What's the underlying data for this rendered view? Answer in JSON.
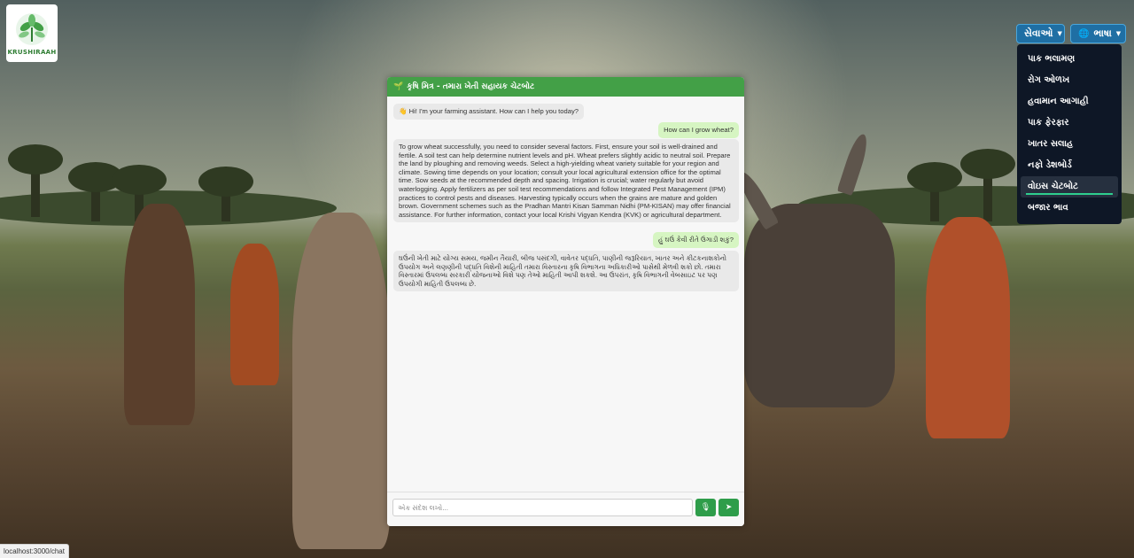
{
  "logo": {
    "text": "KRUSHIRAAH"
  },
  "header": {
    "services_label": "સેવાઓ",
    "language_label": "ભાષા"
  },
  "services_menu": {
    "items": [
      {
        "label": "પાક ભલામણ"
      },
      {
        "label": "રોગ ઓળખ"
      },
      {
        "label": "હવામાન આગાહી"
      },
      {
        "label": "પાક ફેરફાર"
      },
      {
        "label": "ખાતર સલાહ"
      },
      {
        "label": "નફો ડેશબોર્ડ"
      },
      {
        "label": "વોઇસ ચેટબોટ",
        "active": true
      },
      {
        "label": "બજાર ભાવ"
      }
    ]
  },
  "chat": {
    "title": "કૃષિ મિત્ર - તમારા ખેતી સહાયક ચેટબોટ",
    "title_icon": "🌱",
    "messages": [
      {
        "role": "bot",
        "icon": "👋",
        "text": "Hi! I'm your farming assistant. How can I help you today?"
      },
      {
        "role": "user",
        "text": "How can I grow wheat?"
      },
      {
        "role": "bot",
        "text": "To grow wheat successfully, you need to consider several factors. First, ensure your soil is well-drained and fertile. A soil test can help determine nutrient levels and pH. Wheat prefers slightly acidic to neutral soil. Prepare the land by ploughing and removing weeds. Select a high-yielding wheat variety suitable for your region and climate. Sowing time depends on your location; consult your local agricultural extension office for the optimal time. Sow seeds at the recommended depth and spacing. Irrigation is crucial; water regularly but avoid waterlogging. Apply fertilizers as per soil test recommendations and follow Integrated Pest Management (IPM) practices to control pests and diseases. Harvesting typically occurs when the grains are mature and golden brown. Government schemes such as the Pradhan Mantri Kisan Samman Nidhi (PM-KISAN) may offer financial assistance. For further information, contact your local Krishi Vigyan Kendra (KVK) or agricultural department."
      },
      {
        "role": "user",
        "text": "હું ઘઉં કેવી રીતે ઉગાડી શકું?"
      },
      {
        "role": "bot",
        "text": "ઘઉંની ખેતી માટે યોગ્ય સમય, જમીન તૈયારી, બીજ પસંદગી, વાવેતર પદ્ધતિ, પાણીની જરૂરિયાત, ખાતર અને કીટકનાશકોનો ઉપયોગ અને લણણીની પદ્ધતિ વિશેની માહિતી તમારા વિસ્તારના કૃષિ વિભાગના અધિકારીઓ પાસેથી મેળવી શકો છો. તમારા વિસ્તારમાં ઉપલબ્ધ સરકારી યોજનાઓ વિશે પણ તેઓ માહિતી આપી શકશે. આ ઉપરાંત, કૃષિ વિભાગની વેબસાઇટ પર પણ ઉપયોગી માહિતી ઉપલબ્ધ છે."
      }
    ],
    "input_placeholder": "એક સંદેશ લખો...",
    "input_value": "",
    "mic_icon": "🎙",
    "send_icon": "➤"
  },
  "status_bar": {
    "url": "localhost:3000/chat"
  }
}
